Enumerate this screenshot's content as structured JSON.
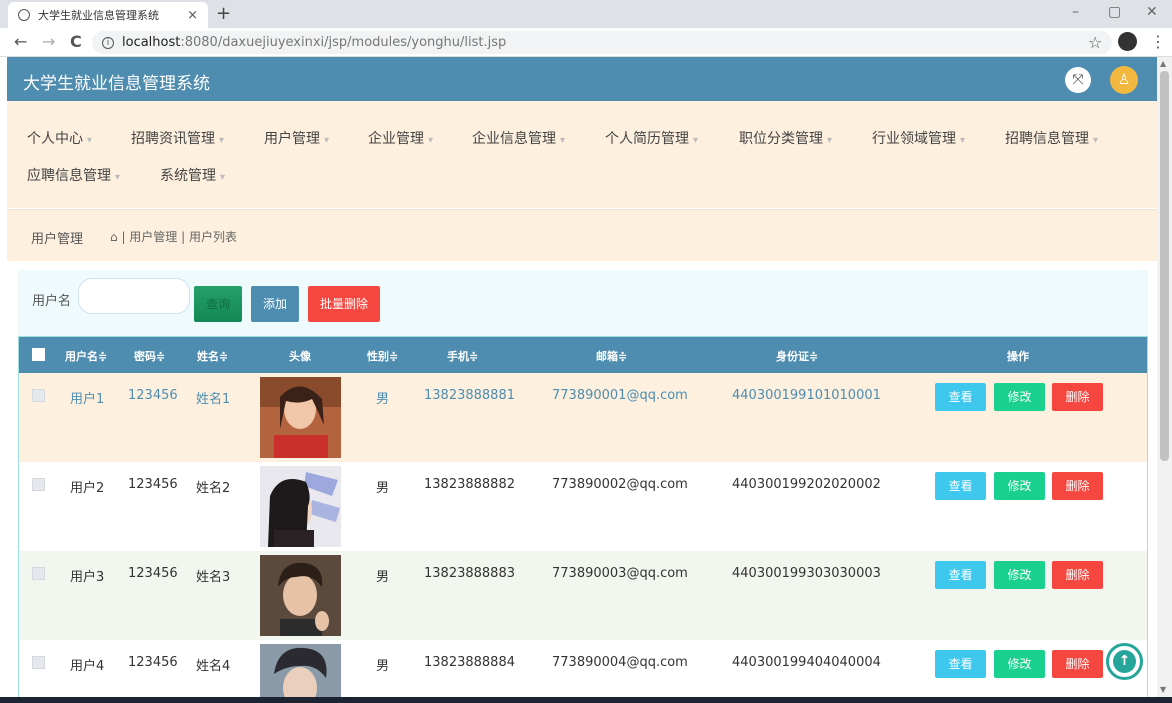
{
  "browser": {
    "tab_title": "大学生就业信息管理系统",
    "tab_close": "×",
    "new_tab": "+",
    "url_host": "localhost",
    "url_path": ":8080/daxuejiuyexinxi/jsp/modules/yonghu/list.jsp",
    "back": "←",
    "forward": "→",
    "reload": "C",
    "info": "i",
    "star": "☆",
    "menu": "⋮",
    "minimize": "–",
    "maximize": "▢",
    "close": "✕"
  },
  "header": {
    "title": "大学生就业信息管理系统",
    "fullscreen_glyph": "⤧",
    "avatar_glyph": "♙"
  },
  "nav": {
    "caret": "▾",
    "items": [
      {
        "label": "个人中心"
      },
      {
        "label": "招聘资讯管理"
      },
      {
        "label": "用户管理"
      },
      {
        "label": "企业管理"
      },
      {
        "label": "企业信息管理"
      },
      {
        "label": "个人简历管理"
      },
      {
        "label": "职位分类管理"
      },
      {
        "label": "行业领域管理"
      },
      {
        "label": "招聘信息管理"
      },
      {
        "label": "应聘信息管理"
      },
      {
        "label": "系统管理"
      }
    ]
  },
  "breadcrumb": {
    "title": "用户管理",
    "home_glyph": "⌂",
    "path": "| 用户管理 | 用户列表"
  },
  "search": {
    "label": "用户名",
    "value": "",
    "search_btn": "查询",
    "add_btn": "添加",
    "batch_delete_btn": "批量删除"
  },
  "table": {
    "columns": [
      "用户名≑",
      "密码≑",
      "姓名≑",
      "头像",
      "性别≑",
      "手机≑",
      "邮箱≑",
      "身份证≑",
      "操作"
    ],
    "view_btn": "查看",
    "edit_btn": "修改",
    "delete_btn": "删除",
    "rows": [
      {
        "username": "用户1",
        "password": "123456",
        "name": "姓名1",
        "gender": "男",
        "phone": "13823888881",
        "email": "773890001@qq.com",
        "idcard": "440300199101010001"
      },
      {
        "username": "用户2",
        "password": "123456",
        "name": "姓名2",
        "gender": "男",
        "phone": "13823888882",
        "email": "773890002@qq.com",
        "idcard": "440300199202020002"
      },
      {
        "username": "用户3",
        "password": "123456",
        "name": "姓名3",
        "gender": "男",
        "phone": "13823888883",
        "email": "773890003@qq.com",
        "idcard": "440300199303030003"
      },
      {
        "username": "用户4",
        "password": "123456",
        "name": "姓名4",
        "gender": "男",
        "phone": "13823888884",
        "email": "773890004@qq.com",
        "idcard": "440300199404040004"
      }
    ]
  },
  "scroll_top_glyph": "↑",
  "colors": {
    "header_bg": "#4e8db0",
    "nav_bg": "#fdf0df",
    "row1_bg": "#fdf0df",
    "row3_bg": "#f1f7ef",
    "link_text": "#4e8db0"
  }
}
